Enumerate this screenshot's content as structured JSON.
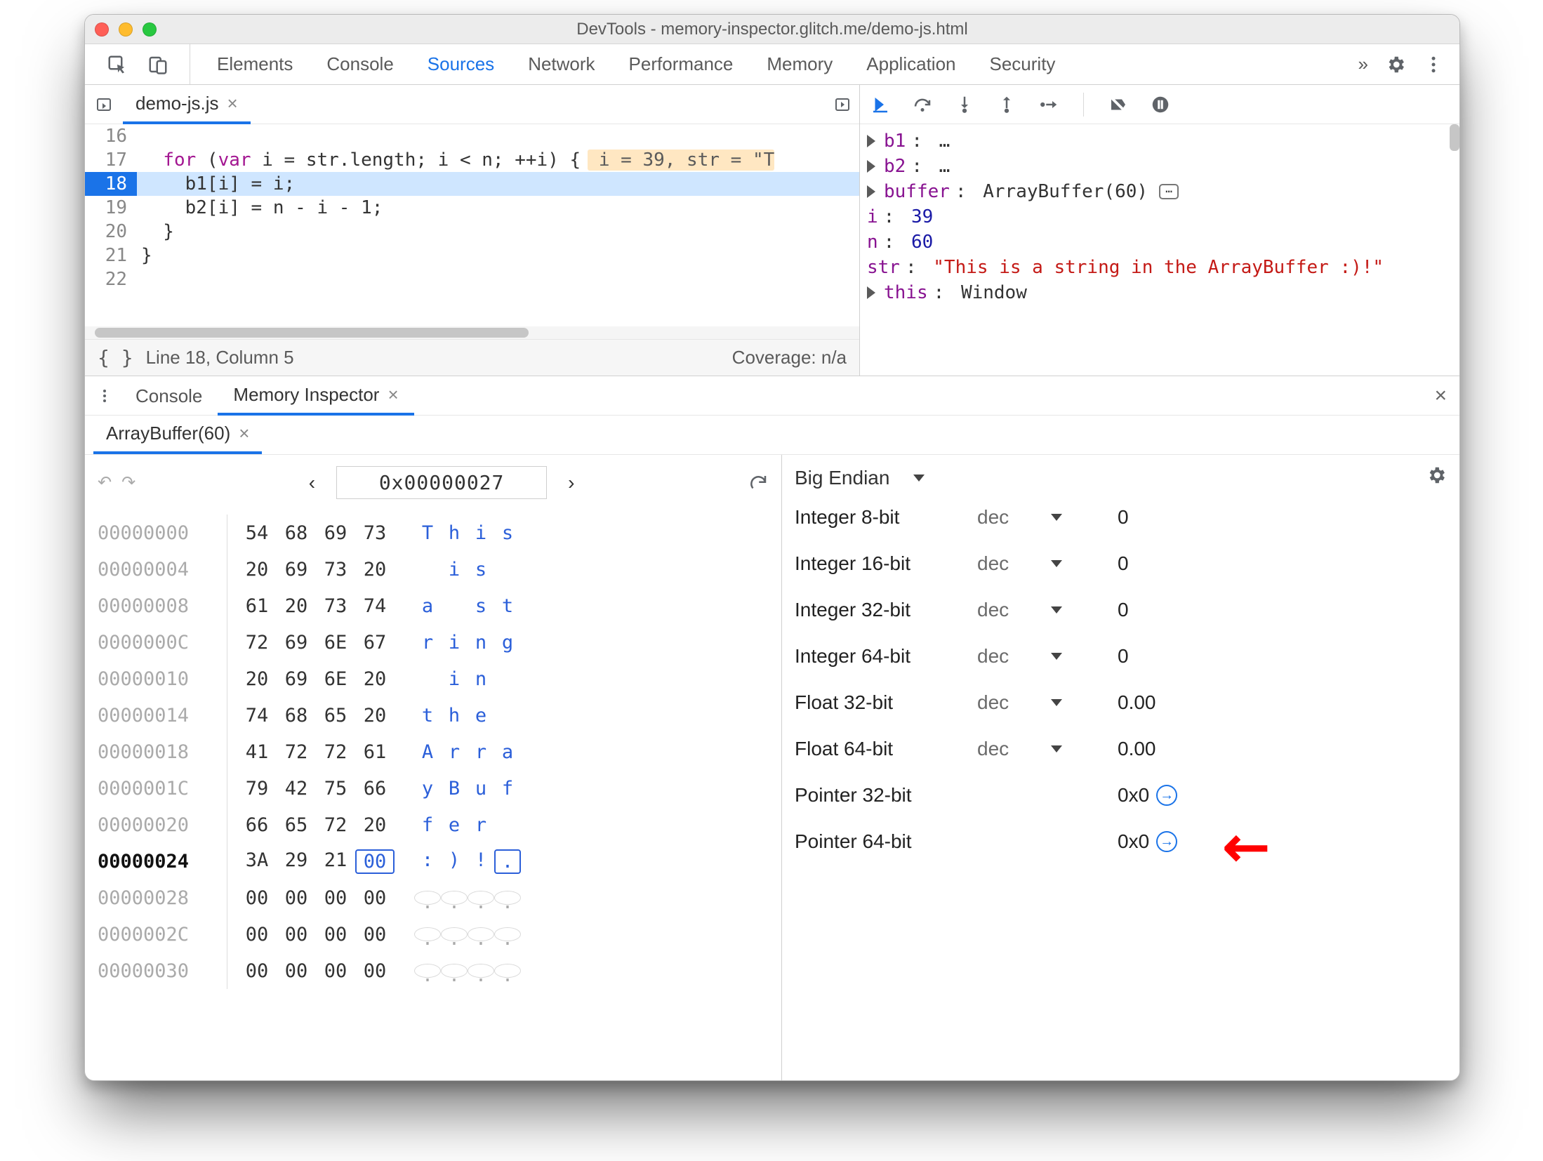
{
  "window": {
    "title": "DevTools - memory-inspector.glitch.me/demo-js.html"
  },
  "panel": {
    "tabs": [
      "Elements",
      "Console",
      "Sources",
      "Network",
      "Performance",
      "Memory",
      "Application",
      "Security"
    ],
    "active_index": 2,
    "more_glyph": "»"
  },
  "editor": {
    "file_tab": "demo-js.js",
    "lines": [
      {
        "n": 16,
        "text": ""
      },
      {
        "n": 17,
        "text": "  for (var i = str.length; i < n; ++i) {",
        "inline": " i = 39, str = \"T"
      },
      {
        "n": 18,
        "text": "    b1[i] = i;",
        "hl": true
      },
      {
        "n": 19,
        "text": "    b2[i] = n - i - 1;"
      },
      {
        "n": 20,
        "text": "  }"
      },
      {
        "n": 21,
        "text": "}"
      },
      {
        "n": 22,
        "text": ""
      }
    ],
    "status_left": "Line 18, Column 5",
    "status_right": "Coverage: n/a"
  },
  "scope": {
    "rows": [
      {
        "prop": "b1",
        "val": "…",
        "tri": true
      },
      {
        "prop": "b2",
        "val": "…",
        "tri": true
      },
      {
        "prop": "buffer",
        "val": "ArrayBuffer(60)",
        "tri": true,
        "chip": true
      },
      {
        "prop": "i",
        "val": "39",
        "indent": true,
        "num": true
      },
      {
        "prop": "n",
        "val": "60",
        "indent": true,
        "num": true
      },
      {
        "prop": "str",
        "val": "\"This is a string in the ArrayBuffer :)!\"",
        "indent": true,
        "str": true
      },
      {
        "prop": "this",
        "val": "Window",
        "tri": true
      }
    ]
  },
  "drawer": {
    "tabs": [
      "Console",
      "Memory Inspector"
    ],
    "active_index": 1,
    "inspector_tab": "ArrayBuffer(60)"
  },
  "memory": {
    "nav": {
      "address": "0x00000027"
    },
    "selected_offset": "00000024",
    "selected_byte_index": 3,
    "rows": [
      {
        "off": "00000000",
        "b": [
          "54",
          "68",
          "69",
          "73"
        ],
        "a": [
          "T",
          "h",
          "i",
          "s"
        ]
      },
      {
        "off": "00000004",
        "b": [
          "20",
          "69",
          "73",
          "20"
        ],
        "a": [
          " ",
          "i",
          "s",
          " "
        ]
      },
      {
        "off": "00000008",
        "b": [
          "61",
          "20",
          "73",
          "74"
        ],
        "a": [
          "a",
          " ",
          "s",
          "t"
        ]
      },
      {
        "off": "0000000C",
        "b": [
          "72",
          "69",
          "6E",
          "67"
        ],
        "a": [
          "r",
          "i",
          "n",
          "g"
        ]
      },
      {
        "off": "00000010",
        "b": [
          "20",
          "69",
          "6E",
          "20"
        ],
        "a": [
          " ",
          "i",
          "n",
          " "
        ]
      },
      {
        "off": "00000014",
        "b": [
          "74",
          "68",
          "65",
          "20"
        ],
        "a": [
          "t",
          "h",
          "e",
          " "
        ]
      },
      {
        "off": "00000018",
        "b": [
          "41",
          "72",
          "72",
          "61"
        ],
        "a": [
          "A",
          "r",
          "r",
          "a"
        ]
      },
      {
        "off": "0000001C",
        "b": [
          "79",
          "42",
          "75",
          "66"
        ],
        "a": [
          "y",
          "B",
          "u",
          "f"
        ]
      },
      {
        "off": "00000020",
        "b": [
          "66",
          "65",
          "72",
          "20"
        ],
        "a": [
          "f",
          "e",
          "r",
          " "
        ]
      },
      {
        "off": "00000024",
        "b": [
          "3A",
          "29",
          "21",
          "00"
        ],
        "a": [
          ":",
          ")",
          "!",
          "."
        ]
      },
      {
        "off": "00000028",
        "b": [
          "00",
          "00",
          "00",
          "00"
        ],
        "a": [
          ".",
          ".",
          ".",
          "."
        ]
      },
      {
        "off": "0000002C",
        "b": [
          "00",
          "00",
          "00",
          "00"
        ],
        "a": [
          ".",
          ".",
          ".",
          "."
        ]
      },
      {
        "off": "00000030",
        "b": [
          "00",
          "00",
          "00",
          "00"
        ],
        "a": [
          ".",
          ".",
          ".",
          "."
        ]
      }
    ]
  },
  "values": {
    "endian_label": "Big Endian",
    "unit_label": "dec",
    "rows": [
      {
        "name": "Integer 8-bit",
        "unit": true,
        "val": "0"
      },
      {
        "name": "Integer 16-bit",
        "unit": true,
        "val": "0"
      },
      {
        "name": "Integer 32-bit",
        "unit": true,
        "val": "0"
      },
      {
        "name": "Integer 64-bit",
        "unit": true,
        "val": "0"
      },
      {
        "name": "Float 32-bit",
        "unit": true,
        "val": "0.00"
      },
      {
        "name": "Float 64-bit",
        "unit": true,
        "val": "0.00"
      },
      {
        "name": "Pointer 32-bit",
        "unit": false,
        "val": "0x0",
        "ptr": true
      },
      {
        "name": "Pointer 64-bit",
        "unit": false,
        "val": "0x0",
        "ptr": true
      }
    ]
  }
}
